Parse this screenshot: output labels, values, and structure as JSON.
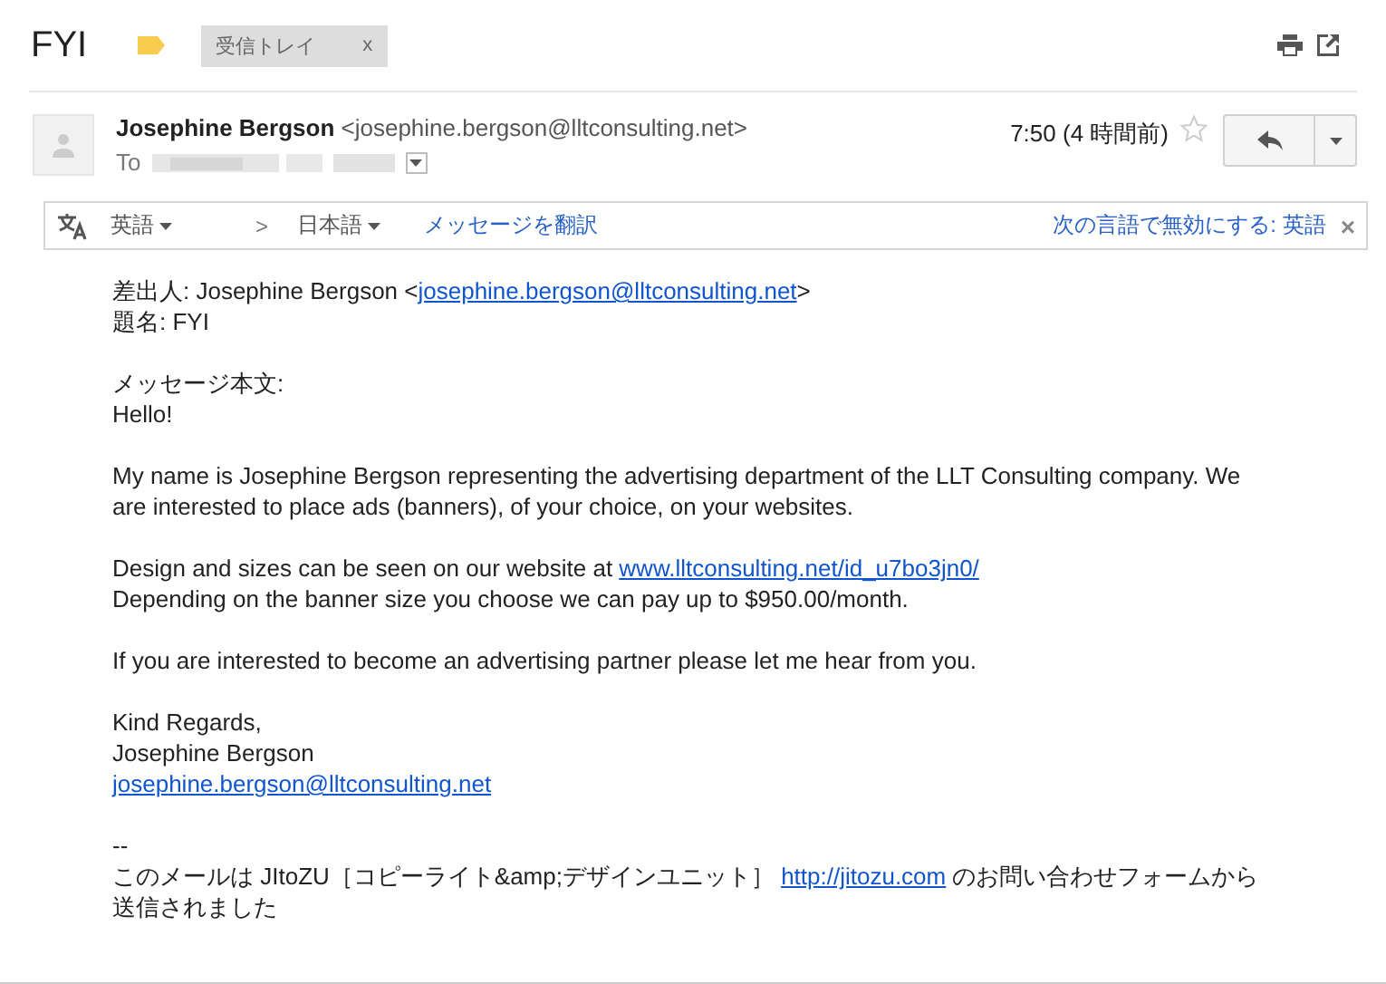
{
  "subject": "FYI",
  "labels": [
    {
      "text": "受信トレイ",
      "remove": "x"
    }
  ],
  "message": {
    "sender_name": "Josephine Bergson",
    "sender_email": "<josephine.bergson@lltconsulting.net>",
    "to_label": "To",
    "time": "7:50 (4 時間前)",
    "starred": false
  },
  "translate_bar": {
    "from": "英語",
    "arrow": ">",
    "to": "日本語",
    "action": "メッセージを翻訳",
    "disable": "次の言語で無効にする: 英語",
    "close": "×"
  },
  "body": [
    [
      [
        {
          "kind": "text",
          "text": "差出人: Josephine Bergson <"
        },
        {
          "kind": "link",
          "text": "josephine.bergson@lltconsulting.net"
        },
        {
          "kind": "text",
          "text": ">"
        }
      ],
      [
        {
          "kind": "text",
          "text": "題名: FYI"
        }
      ]
    ],
    [
      [
        {
          "kind": "text",
          "text": "メッセージ本文:"
        }
      ],
      [
        {
          "kind": "text",
          "text": "Hello!"
        }
      ]
    ],
    [
      [
        {
          "kind": "text",
          "text": "My name is Josephine Bergson representing the advertising department of the LLT Consulting company. We are interested to place ads (banners), of your choice, on your websites."
        }
      ]
    ],
    [
      [
        {
          "kind": "text",
          "text": "Design and sizes can be seen on our website at "
        },
        {
          "kind": "link",
          "text": "www.lltconsulting.net/id_u7bo3jn0/"
        }
      ],
      [
        {
          "kind": "text",
          "text": "Depending on the banner size you choose we can pay up to $950.00/month."
        }
      ]
    ],
    [
      [
        {
          "kind": "text",
          "text": "If you are interested to become an advertising partner please let me hear from you."
        }
      ]
    ],
    [
      [
        {
          "kind": "text",
          "text": "Kind Regards,"
        }
      ],
      [
        {
          "kind": "text",
          "text": "Josephine Bergson"
        }
      ],
      [
        {
          "kind": "link",
          "text": "josephine.bergson@lltconsulting.net"
        }
      ]
    ],
    [
      [
        {
          "kind": "text",
          "text": "--"
        }
      ],
      [
        {
          "kind": "text",
          "text": "このメールは JItoZU［コピーライト&amp;デザインユニット］ "
        },
        {
          "kind": "link",
          "text": "http://jitozu.com"
        },
        {
          "kind": "text",
          "text": " のお問い合わせフォームから送信されました"
        }
      ]
    ]
  ]
}
